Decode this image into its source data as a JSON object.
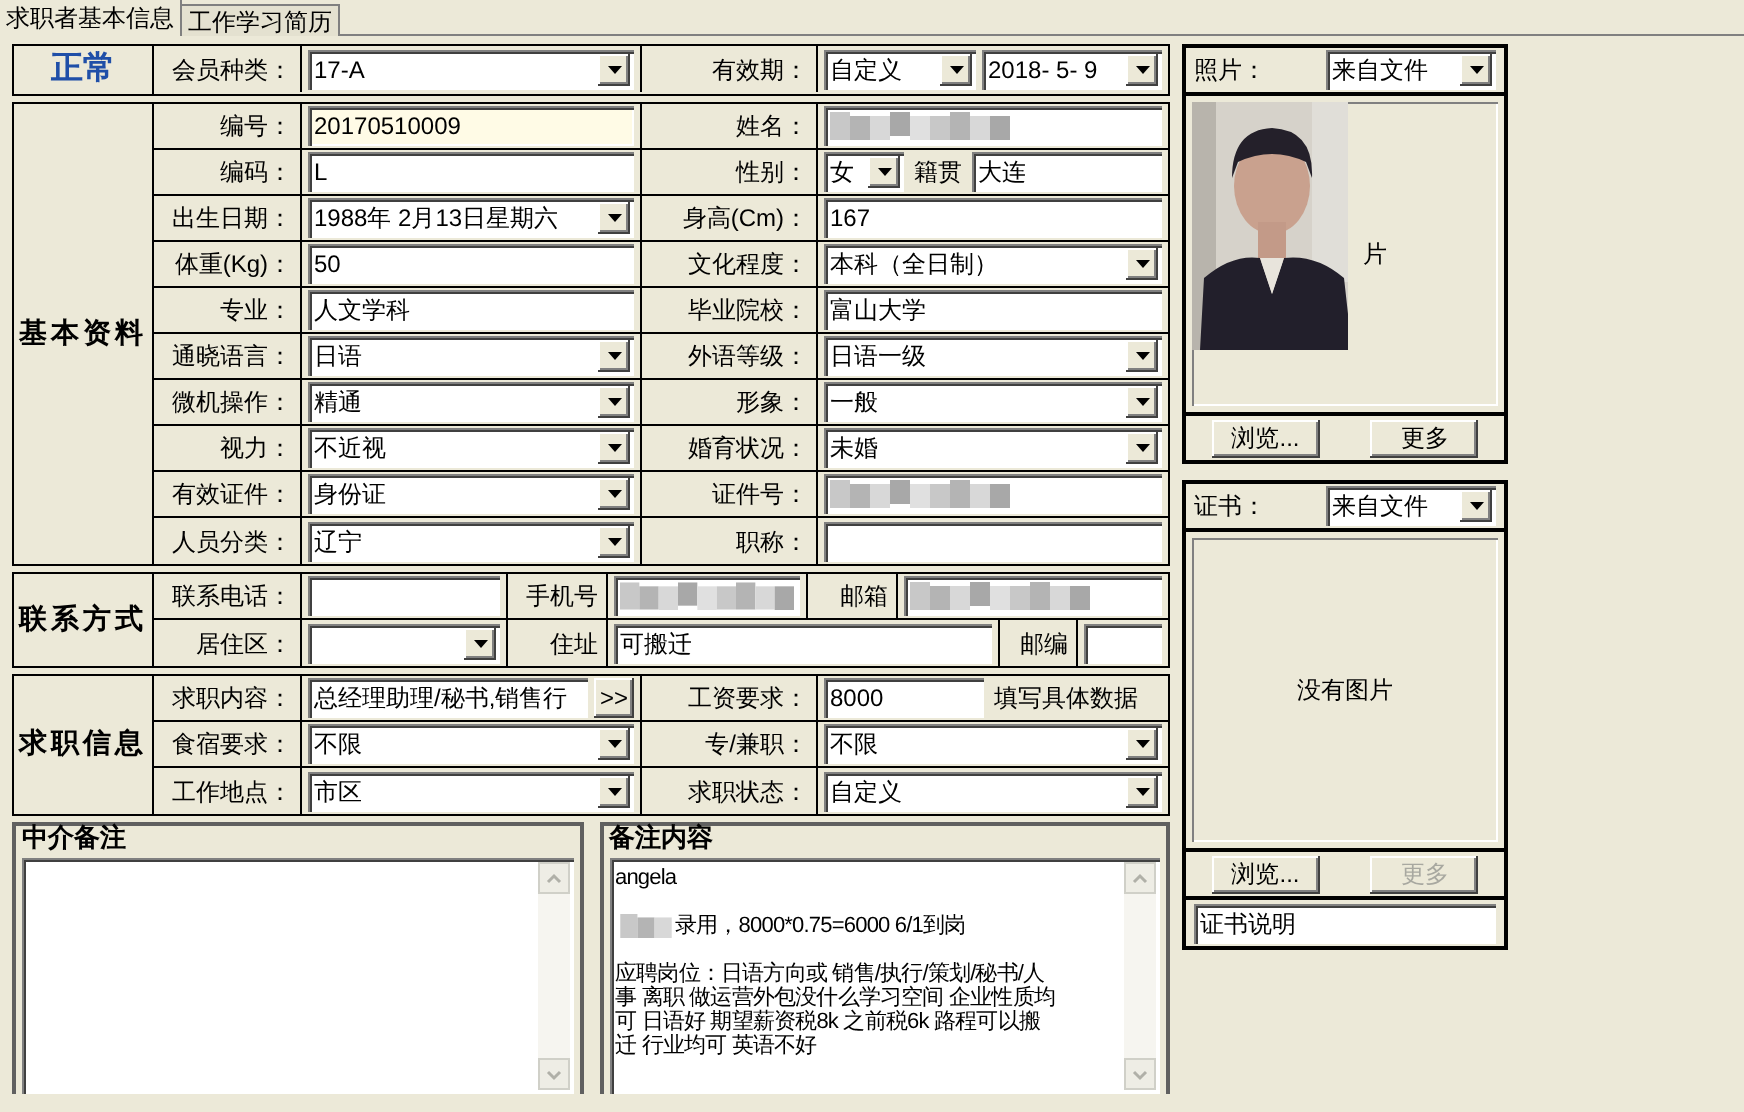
{
  "tabs": [
    {
      "label": "求职者基本信息",
      "selected": true
    },
    {
      "label": "工作学习简历",
      "selected": false
    }
  ],
  "sections": [
    {
      "title": "正常",
      "kind": "status",
      "rows": [
        [
          {
            "label": "会员种类："
          },
          {
            "controls": [
              {
                "kind": "combo",
                "value": "17-A"
              }
            ]
          },
          {
            "label": "有效期："
          },
          {
            "controls": [
              {
                "kind": "combo",
                "value": "自定义"
              },
              {
                "kind": "combo",
                "value": "2018- 5- 9"
              }
            ]
          }
        ]
      ]
    },
    {
      "title": "基本资料",
      "kind": "basic",
      "rows": [
        [
          {
            "label": "编号："
          },
          {
            "controls": [
              {
                "kind": "text",
                "value": "20170510009",
                "highlighted": true
              }
            ]
          },
          {
            "label": "姓名："
          },
          {
            "controls": [
              {
                "kind": "redacted"
              }
            ]
          }
        ],
        [
          {
            "label": "编码："
          },
          {
            "controls": [
              {
                "kind": "text",
                "value": "L"
              }
            ]
          },
          {
            "label": "性别："
          },
          {
            "controls": [
              {
                "kind": "combo",
                "value": "女"
              },
              {
                "kind": "caption",
                "value": "籍贯"
              },
              {
                "kind": "text",
                "value": "大连"
              }
            ]
          }
        ],
        [
          {
            "label": "出生日期："
          },
          {
            "controls": [
              {
                "kind": "combo",
                "value": "1988年 2月13日星期六"
              }
            ]
          },
          {
            "label": "身高(Cm)："
          },
          {
            "controls": [
              {
                "kind": "text",
                "value": "167"
              }
            ]
          }
        ],
        [
          {
            "label": "体重(Kg)："
          },
          {
            "controls": [
              {
                "kind": "text",
                "value": "50"
              }
            ]
          },
          {
            "label": "文化程度："
          },
          {
            "controls": [
              {
                "kind": "combo",
                "value": "本科（全日制）"
              }
            ]
          }
        ],
        [
          {
            "label": "专业："
          },
          {
            "controls": [
              {
                "kind": "text",
                "value": "人文学科"
              }
            ]
          },
          {
            "label": "毕业院校："
          },
          {
            "controls": [
              {
                "kind": "text",
                "value": "富山大学"
              }
            ]
          }
        ],
        [
          {
            "label": "通晓语言："
          },
          {
            "controls": [
              {
                "kind": "combo",
                "value": "日语"
              }
            ]
          },
          {
            "label": "外语等级："
          },
          {
            "controls": [
              {
                "kind": "combo",
                "value": "日语一级"
              }
            ]
          }
        ],
        [
          {
            "label": "微机操作："
          },
          {
            "controls": [
              {
                "kind": "combo",
                "value": "精通"
              }
            ]
          },
          {
            "label": "形象："
          },
          {
            "controls": [
              {
                "kind": "combo",
                "value": "一般"
              }
            ]
          }
        ],
        [
          {
            "label": "视力："
          },
          {
            "controls": [
              {
                "kind": "combo",
                "value": "不近视"
              }
            ]
          },
          {
            "label": "婚育状况："
          },
          {
            "controls": [
              {
                "kind": "combo",
                "value": "未婚"
              }
            ]
          }
        ],
        [
          {
            "label": "有效证件："
          },
          {
            "controls": [
              {
                "kind": "combo",
                "value": "身份证"
              }
            ]
          },
          {
            "label": "证件号："
          },
          {
            "controls": [
              {
                "kind": "redacted"
              }
            ]
          }
        ],
        [
          {
            "label": "人员分类："
          },
          {
            "controls": [
              {
                "kind": "combo",
                "value": "辽宁"
              }
            ]
          },
          {
            "label": "职称："
          },
          {
            "controls": [
              {
                "kind": "text"
              }
            ]
          }
        ]
      ]
    },
    {
      "title": "联系方式",
      "kind": "contact",
      "rows": [
        [
          {
            "label": "联系电话："
          },
          {
            "controls": [
              {
                "kind": "text"
              }
            ]
          },
          {
            "label": "手机号"
          },
          {
            "controls": [
              {
                "kind": "redacted"
              }
            ]
          },
          {
            "label": "邮箱"
          },
          {
            "controls": [
              {
                "kind": "redacted"
              }
            ]
          }
        ],
        [
          {
            "label": "居住区："
          },
          {
            "controls": [
              {
                "kind": "combo"
              }
            ]
          },
          {
            "label": "住址"
          },
          {
            "controls": [
              {
                "kind": "text",
                "value": "可搬迁"
              }
            ]
          },
          {
            "label": "邮编"
          },
          {
            "controls": [
              {
                "kind": "text"
              }
            ]
          }
        ]
      ]
    },
    {
      "title": "求职信息",
      "kind": "job",
      "rows": [
        [
          {
            "label": "求职内容："
          },
          {
            "controls": [
              {
                "kind": "text",
                "value": "总经理助理/秘书,销售行"
              },
              {
                "kind": "button",
                "value": ">>"
              }
            ]
          },
          {
            "label": "工资要求："
          },
          {
            "controls": [
              {
                "kind": "text",
                "value": "8000"
              },
              {
                "kind": "caption",
                "value": "填写具体数据"
              }
            ]
          }
        ],
        [
          {
            "label": "食宿要求："
          },
          {
            "controls": [
              {
                "kind": "combo",
                "value": "不限"
              }
            ]
          },
          {
            "label": "专/兼职："
          },
          {
            "controls": [
              {
                "kind": "combo",
                "value": "不限"
              }
            ]
          }
        ],
        [
          {
            "label": "工作地点："
          },
          {
            "controls": [
              {
                "kind": "combo",
                "value": "市区"
              }
            ]
          },
          {
            "label": "求职状态："
          },
          {
            "controls": [
              {
                "kind": "combo",
                "value": "自定义"
              }
            ]
          }
        ]
      ]
    }
  ],
  "notes": [
    {
      "title": "中介备注"
    },
    {
      "title": "备注内容",
      "paragraphs": [
        {
          "text": "angela"
        },
        {
          "text": "录用，8000*0.75=6000 6/1到岗",
          "redacted_prefix": true
        },
        {
          "lines": [
            "应聘岗位：日语方向或 销售/执行/策划/秘书/人",
            "事 离职 做运营外包没什么学习空间 企业性质均",
            "可 日语好 期望薪资税8k 之前税6k 路程可以搬",
            "迁 行业均可  英语不好"
          ]
        }
      ]
    }
  ],
  "photo": {
    "label": "照片：",
    "source": "来自文件",
    "caption": "片",
    "buttons": [
      {
        "label": "浏览...",
        "disabled": false
      },
      {
        "label": "更多",
        "disabled": false
      }
    ]
  },
  "certificate": {
    "label": "证书：",
    "source": "来自文件",
    "caption": "没有图片",
    "buttons": [
      {
        "label": "浏览...",
        "disabled": false
      },
      {
        "label": "更多",
        "disabled": true
      }
    ],
    "description": "证书说明"
  }
}
